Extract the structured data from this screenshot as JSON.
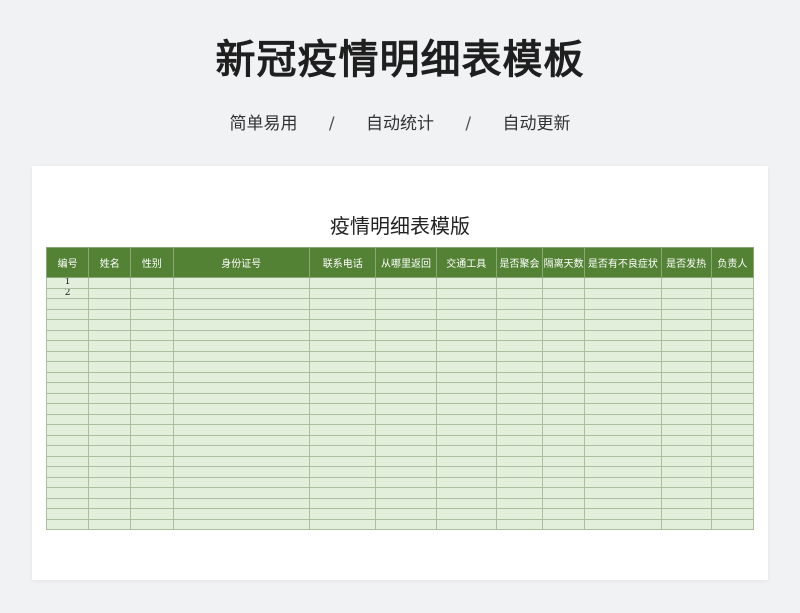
{
  "page": {
    "title": "新冠疫情明细表模板",
    "subtitle": [
      "简单易用",
      "自动统计",
      "自动更新"
    ],
    "separator": "/"
  },
  "sheet": {
    "title": "疫情明细表模版",
    "columns": [
      "编号",
      "姓名",
      "性别",
      "身份证号",
      "联系电话",
      "从哪里返回",
      "交通工具",
      "是否聚会",
      "隔离天数",
      "是否有不良症状",
      "是否发热",
      "负责人"
    ],
    "column_widths": [
      42,
      42,
      42,
      136,
      66,
      60,
      60,
      46,
      42,
      76,
      50,
      42
    ],
    "row_numbers": [
      "1",
      "2"
    ],
    "row_count": 24
  }
}
